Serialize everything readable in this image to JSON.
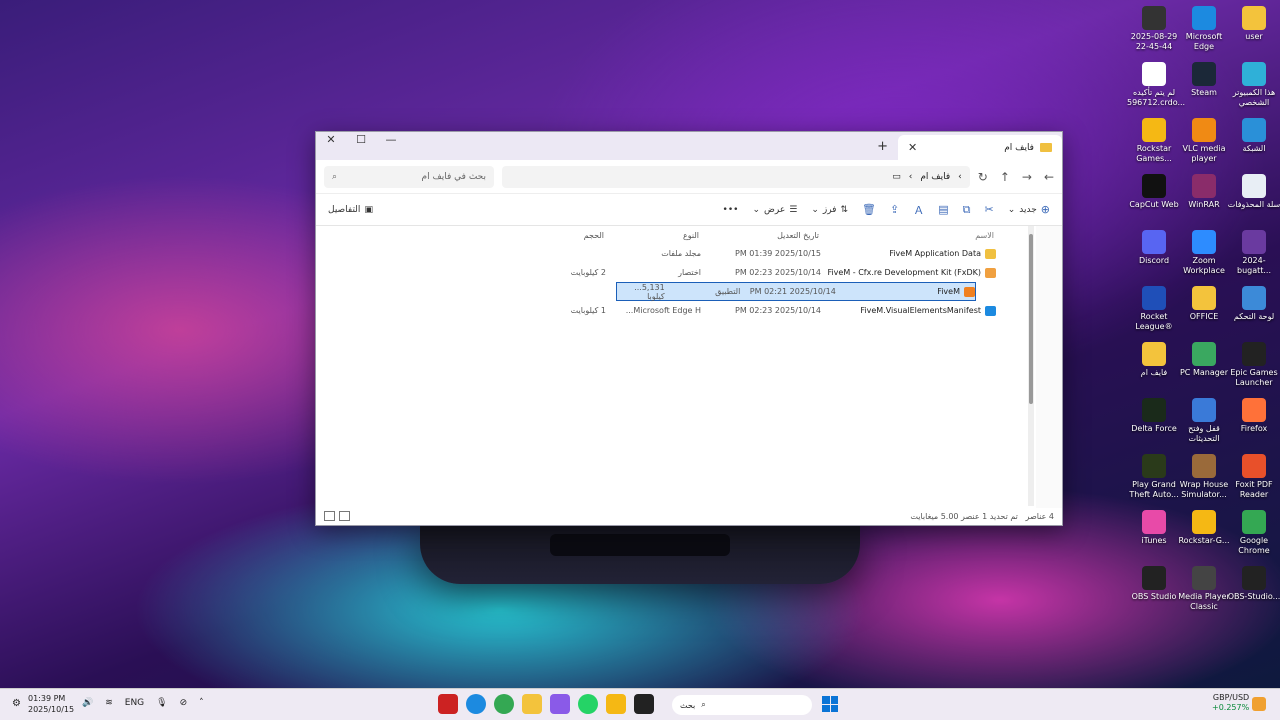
{
  "desktop": {
    "icons": [
      {
        "label": "user",
        "icon": "folder-icon",
        "color": "#f3c33c"
      },
      {
        "label": "Microsoft Edge",
        "icon": "edge-icon",
        "color": "#1c8ae0"
      },
      {
        "label": "2025-08-29 22-45-44",
        "icon": "monitor-icon",
        "color": "#333"
      },
      {
        "label": "هذا الكمبيوتر الشخصي",
        "icon": "computer-icon",
        "color": "#2fb0d8"
      },
      {
        "label": "Steam",
        "icon": "steam-icon",
        "color": "#1b2838"
      },
      {
        "label": "لم يتم تأكيده 596712.crdo...",
        "icon": "file-icon",
        "color": "#ffffff"
      },
      {
        "label": "الشبكة",
        "icon": "network-icon",
        "color": "#2a90d8"
      },
      {
        "label": "VLC media player",
        "icon": "vlc-icon",
        "color": "#f08a14"
      },
      {
        "label": "Rockstar Games...",
        "icon": "rockstar-icon",
        "color": "#f5b814"
      },
      {
        "label": "سلة المحذوفات",
        "icon": "recycle-bin-icon",
        "color": "#e8eef5"
      },
      {
        "label": "WinRAR",
        "icon": "winrar-icon",
        "color": "#8a2c6a"
      },
      {
        "label": "CapCut Web",
        "icon": "capcut-icon",
        "color": "#111111"
      },
      {
        "label": "2024-bugatt...",
        "icon": "image-icon",
        "color": "#6a3aa0"
      },
      {
        "label": "Zoom Workplace",
        "icon": "zoom-icon",
        "color": "#2d8cff"
      },
      {
        "label": "Discord",
        "icon": "discord-icon",
        "color": "#5865f2"
      },
      {
        "label": "لوحة التحكم",
        "icon": "control-panel-icon",
        "color": "#3c8ad8"
      },
      {
        "label": "OFFICE",
        "icon": "folder-icon",
        "color": "#f3c33c"
      },
      {
        "label": "Rocket League®",
        "icon": "rocket-league-icon",
        "color": "#1f4fb8"
      },
      {
        "label": "Epic Games Launcher",
        "icon": "epic-icon",
        "color": "#222222"
      },
      {
        "label": "PC Manager",
        "icon": "pc-manager-icon",
        "color": "#3aa860"
      },
      {
        "label": "فايف ام",
        "icon": "folder-icon",
        "color": "#f3c33c"
      },
      {
        "label": "Firefox",
        "icon": "firefox-icon",
        "color": "#ff7139"
      },
      {
        "label": "قفل وفتح التحديثات",
        "icon": "updates-icon",
        "color": "#3a7ad8"
      },
      {
        "label": "Delta Force",
        "icon": "delta-force-icon",
        "color": "#1a2a1a"
      },
      {
        "label": "Foxit PDF Reader",
        "icon": "foxit-icon",
        "color": "#e8502a"
      },
      {
        "label": "Wrap House Simulator...",
        "icon": "game-icon",
        "color": "#9a6a3a"
      },
      {
        "label": "Play Grand Theft Auto...",
        "icon": "gta-icon",
        "color": "#2a3a1a"
      },
      {
        "label": "Google Chrome",
        "icon": "chrome-icon",
        "color": "#34a853"
      },
      {
        "label": "Rockstar-G...",
        "icon": "rockstar-icon",
        "color": "#f5b814"
      },
      {
        "label": "iTunes",
        "icon": "itunes-icon",
        "color": "#e84aa8"
      },
      {
        "label": "OBS-Studio...",
        "icon": "obs-icon",
        "color": "#222222"
      },
      {
        "label": "Media Player Classic",
        "icon": "mpc-icon",
        "color": "#444444"
      },
      {
        "label": "OBS Studio",
        "icon": "obs-icon",
        "color": "#222222"
      }
    ]
  },
  "window": {
    "tab_title": "فايف ام",
    "breadcrumb": [
      "فايف ام"
    ],
    "search_placeholder": "بحث في فايف ام",
    "toolbar": {
      "new": "جديد",
      "sort": "فرز",
      "view": "عرض",
      "details": "التفاصيل"
    },
    "columns": [
      "الاسم",
      "تاريخ التعديل",
      "النوع",
      "الحجم"
    ],
    "files": [
      {
        "name": "FiveM Application Data",
        "date": "2025/10/15 01:39 PM",
        "type": "مجلد ملفات",
        "size": "",
        "icon": "folder-icon",
        "selected": false
      },
      {
        "name": "FiveM - Cfx.re Development Kit (FxDK)",
        "date": "2025/10/14 02:23 PM",
        "type": "اختصار",
        "size": "2 كيلوبايت",
        "icon": "shortcut-icon",
        "selected": false
      },
      {
        "name": "FiveM",
        "date": "2025/10/14 02:21 PM",
        "type": "التطبيق",
        "size": "5,131... كيلوبا",
        "icon": "fivem-icon",
        "selected": true
      },
      {
        "name": "FiveM.VisualElementsManifest",
        "date": "2025/10/14 02:23 PM",
        "type": "Microsoft Edge H...",
        "size": "1 كيلوبايت",
        "icon": "edge-icon",
        "selected": false
      }
    ],
    "status": {
      "count": "4 عناصر",
      "selection": "تم تحديد 1 عنصر  5.00 ميغابايت"
    }
  },
  "taskbar": {
    "time": "01:39 PM",
    "date": "2025/10/15",
    "lang": "ENG",
    "search_placeholder": "بحث",
    "fx_pair": "GBP/USD",
    "fx_change": "+0.257%"
  }
}
